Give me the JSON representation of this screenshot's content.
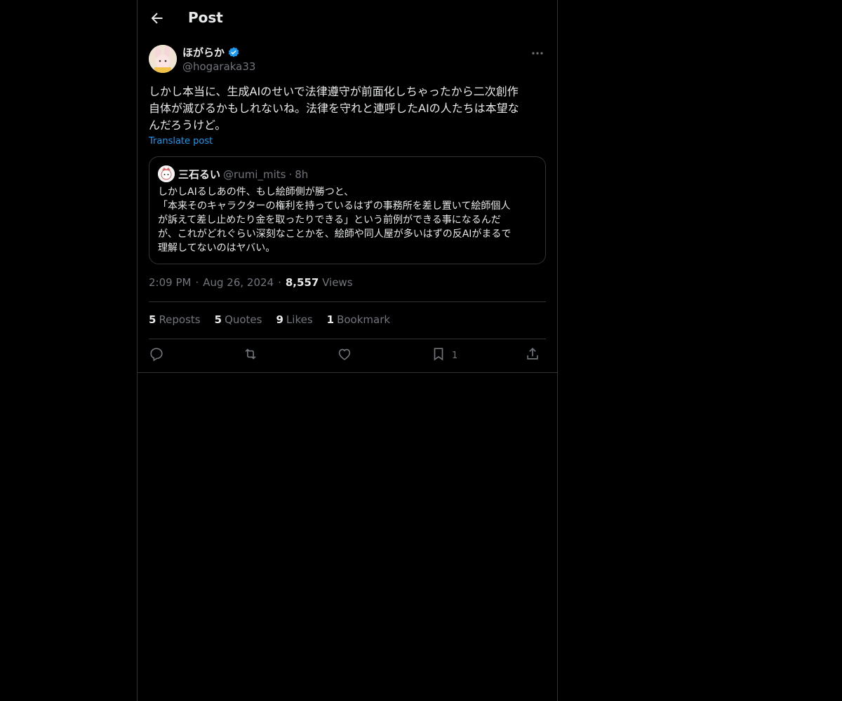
{
  "header": {
    "title": "Post",
    "back_icon": "arrow-left-icon"
  },
  "author": {
    "name": "ほがらか",
    "handle": "@hogaraka33",
    "verified_icon": "verified-badge-icon",
    "more_icon": "more-horizontal-icon"
  },
  "post": {
    "text": "しかし本当に、生成AIのせいで法律遵守が前面化しちゃったから二次創作\n自体が滅びるかもしれないね。法律を守れと連呼したAIの人たちは本望な\nんだろうけど。",
    "translate_label": "Translate post"
  },
  "quote": {
    "name": "三石るい",
    "handle": "@rumi_mits",
    "separator": "·",
    "time": "8h",
    "text": "しかしAIるしあの件、もし絵師側が勝つと、\n「本来そのキャラクターの権利を持っているはずの事務所を差し置いて絵師個人\nが訴えて差し止めたり金を取ったりできる」という前例ができる事になるんだ\nが、これがどれぐらい深刻なことかを、絵師や同人屋が多いはずの反AIがまるで\n理解してないのはヤバい。"
  },
  "meta": {
    "time": "2:09 PM",
    "sep1": "·",
    "date": "Aug 26, 2024",
    "sep2": "·",
    "views_count": "8,557",
    "views_label": "Views"
  },
  "stats": {
    "reposts_count": "5",
    "reposts_label": "Reposts",
    "quotes_count": "5",
    "quotes_label": "Quotes",
    "likes_count": "9",
    "likes_label": "Likes",
    "bookmarks_count": "1",
    "bookmarks_label": "Bookmark"
  },
  "actions": {
    "reply_icon": "reply-icon",
    "repost_icon": "repost-icon",
    "like_icon": "heart-icon",
    "bookmark_icon": "bookmark-icon",
    "bookmark_count": "1",
    "share_icon": "share-icon"
  },
  "colors": {
    "background": "#000000",
    "accent": "#1d9bf0",
    "secondary_text": "#71767b",
    "border": "#2f3336"
  }
}
